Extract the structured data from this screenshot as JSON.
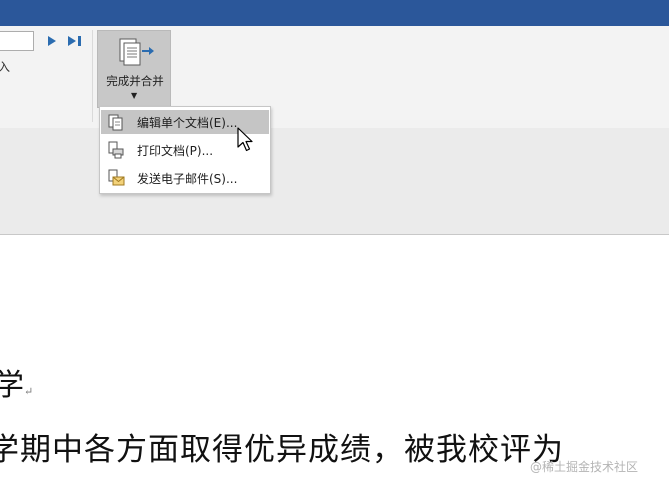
{
  "app": {
    "title_bar_color": "#2b579a",
    "ribbon_bg": "#f3f3f3",
    "highlight_color": "#c5c5c5"
  },
  "ribbon": {
    "record_input_value": "",
    "partial_label": "入",
    "nav_next_icon": "next-record-icon",
    "nav_last_icon": "last-record-icon",
    "finish_merge": {
      "label": "完成并合并",
      "icon": "finish-merge-icon",
      "caret": "▼"
    }
  },
  "finish_merge_menu": {
    "items": [
      {
        "label": "编辑单个文档(E)...",
        "icon": "edit-documents-icon",
        "highlighted": true
      },
      {
        "label": "打印文档(P)...",
        "icon": "print-documents-icon",
        "highlighted": false
      },
      {
        "label": "发送电子邮件(S)...",
        "icon": "send-email-icon",
        "highlighted": false
      }
    ]
  },
  "document": {
    "line1": "学",
    "line2": "学期中各方面取得优异成绩，被我校评为",
    "paragraph_mark": "↵"
  },
  "watermark": "@稀土掘金技术社区"
}
